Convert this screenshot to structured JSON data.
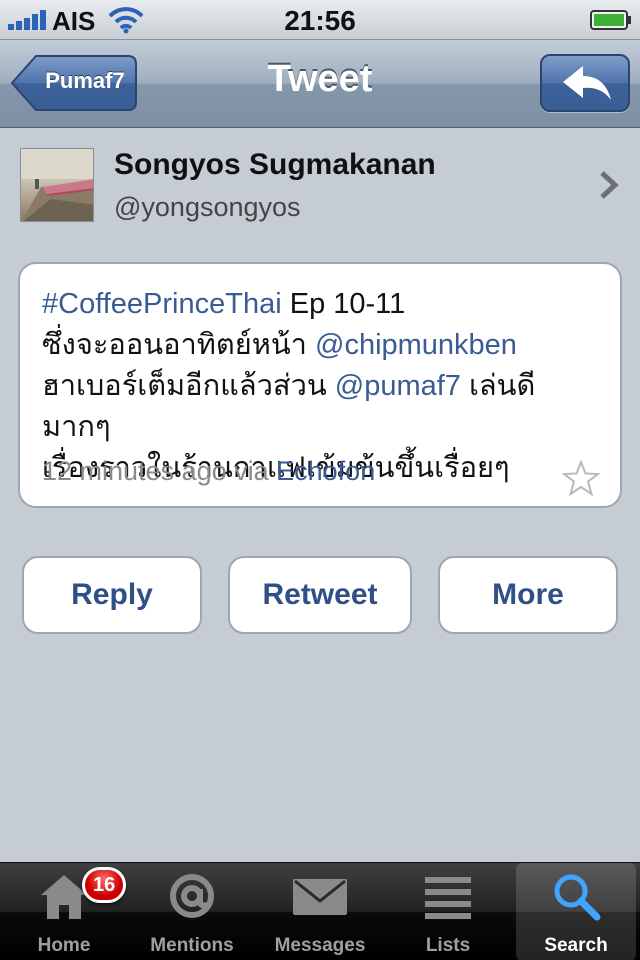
{
  "status_bar": {
    "carrier": "AIS",
    "time": "21:56",
    "icons": [
      "signal-bars-icon",
      "wifi-icon",
      "battery-icon"
    ]
  },
  "nav": {
    "back_label": "Pumaf7",
    "title": "Tweet",
    "reply_icon": "reply-arrow-icon"
  },
  "user": {
    "name": "Songyos Sugmakanan",
    "handle": "@yongsongyos"
  },
  "tweet": {
    "hashtag": "#CoffeePrinceThai",
    "line1_rest": " Ep 10-11",
    "line2_text": "ซึ่งจะออนอาทิตย์หน้า ",
    "line2_mention": "@chipmunkben",
    "line3_text": "ฮาเบอร์เต็มอีกแล้วส่วน ",
    "line3_mention": "@pumaf7",
    "line3_rest": " เล่นดีมากๆ",
    "line4_text": "เรื่องราวในร้านกาแฟเข้มข้นขึ้นเรื่อยๆ",
    "time_ago": "12 minutes ago via ",
    "via_app": "Echofon"
  },
  "actions": {
    "reply": "Reply",
    "retweet": "Retweet",
    "more": "More"
  },
  "tabbar": {
    "items": [
      {
        "label": "Home",
        "icon": "home-icon",
        "badge": "16"
      },
      {
        "label": "Mentions",
        "icon": "at-sign-icon"
      },
      {
        "label": "Messages",
        "icon": "envelope-icon"
      },
      {
        "label": "Lists",
        "icon": "list-icon"
      },
      {
        "label": "Search",
        "icon": "search-icon",
        "active": true
      }
    ]
  },
  "colors": {
    "background": "#c5ccd4",
    "link": "#3a5b94",
    "button_text": "#2f4f86",
    "badge": "#cc0000"
  }
}
